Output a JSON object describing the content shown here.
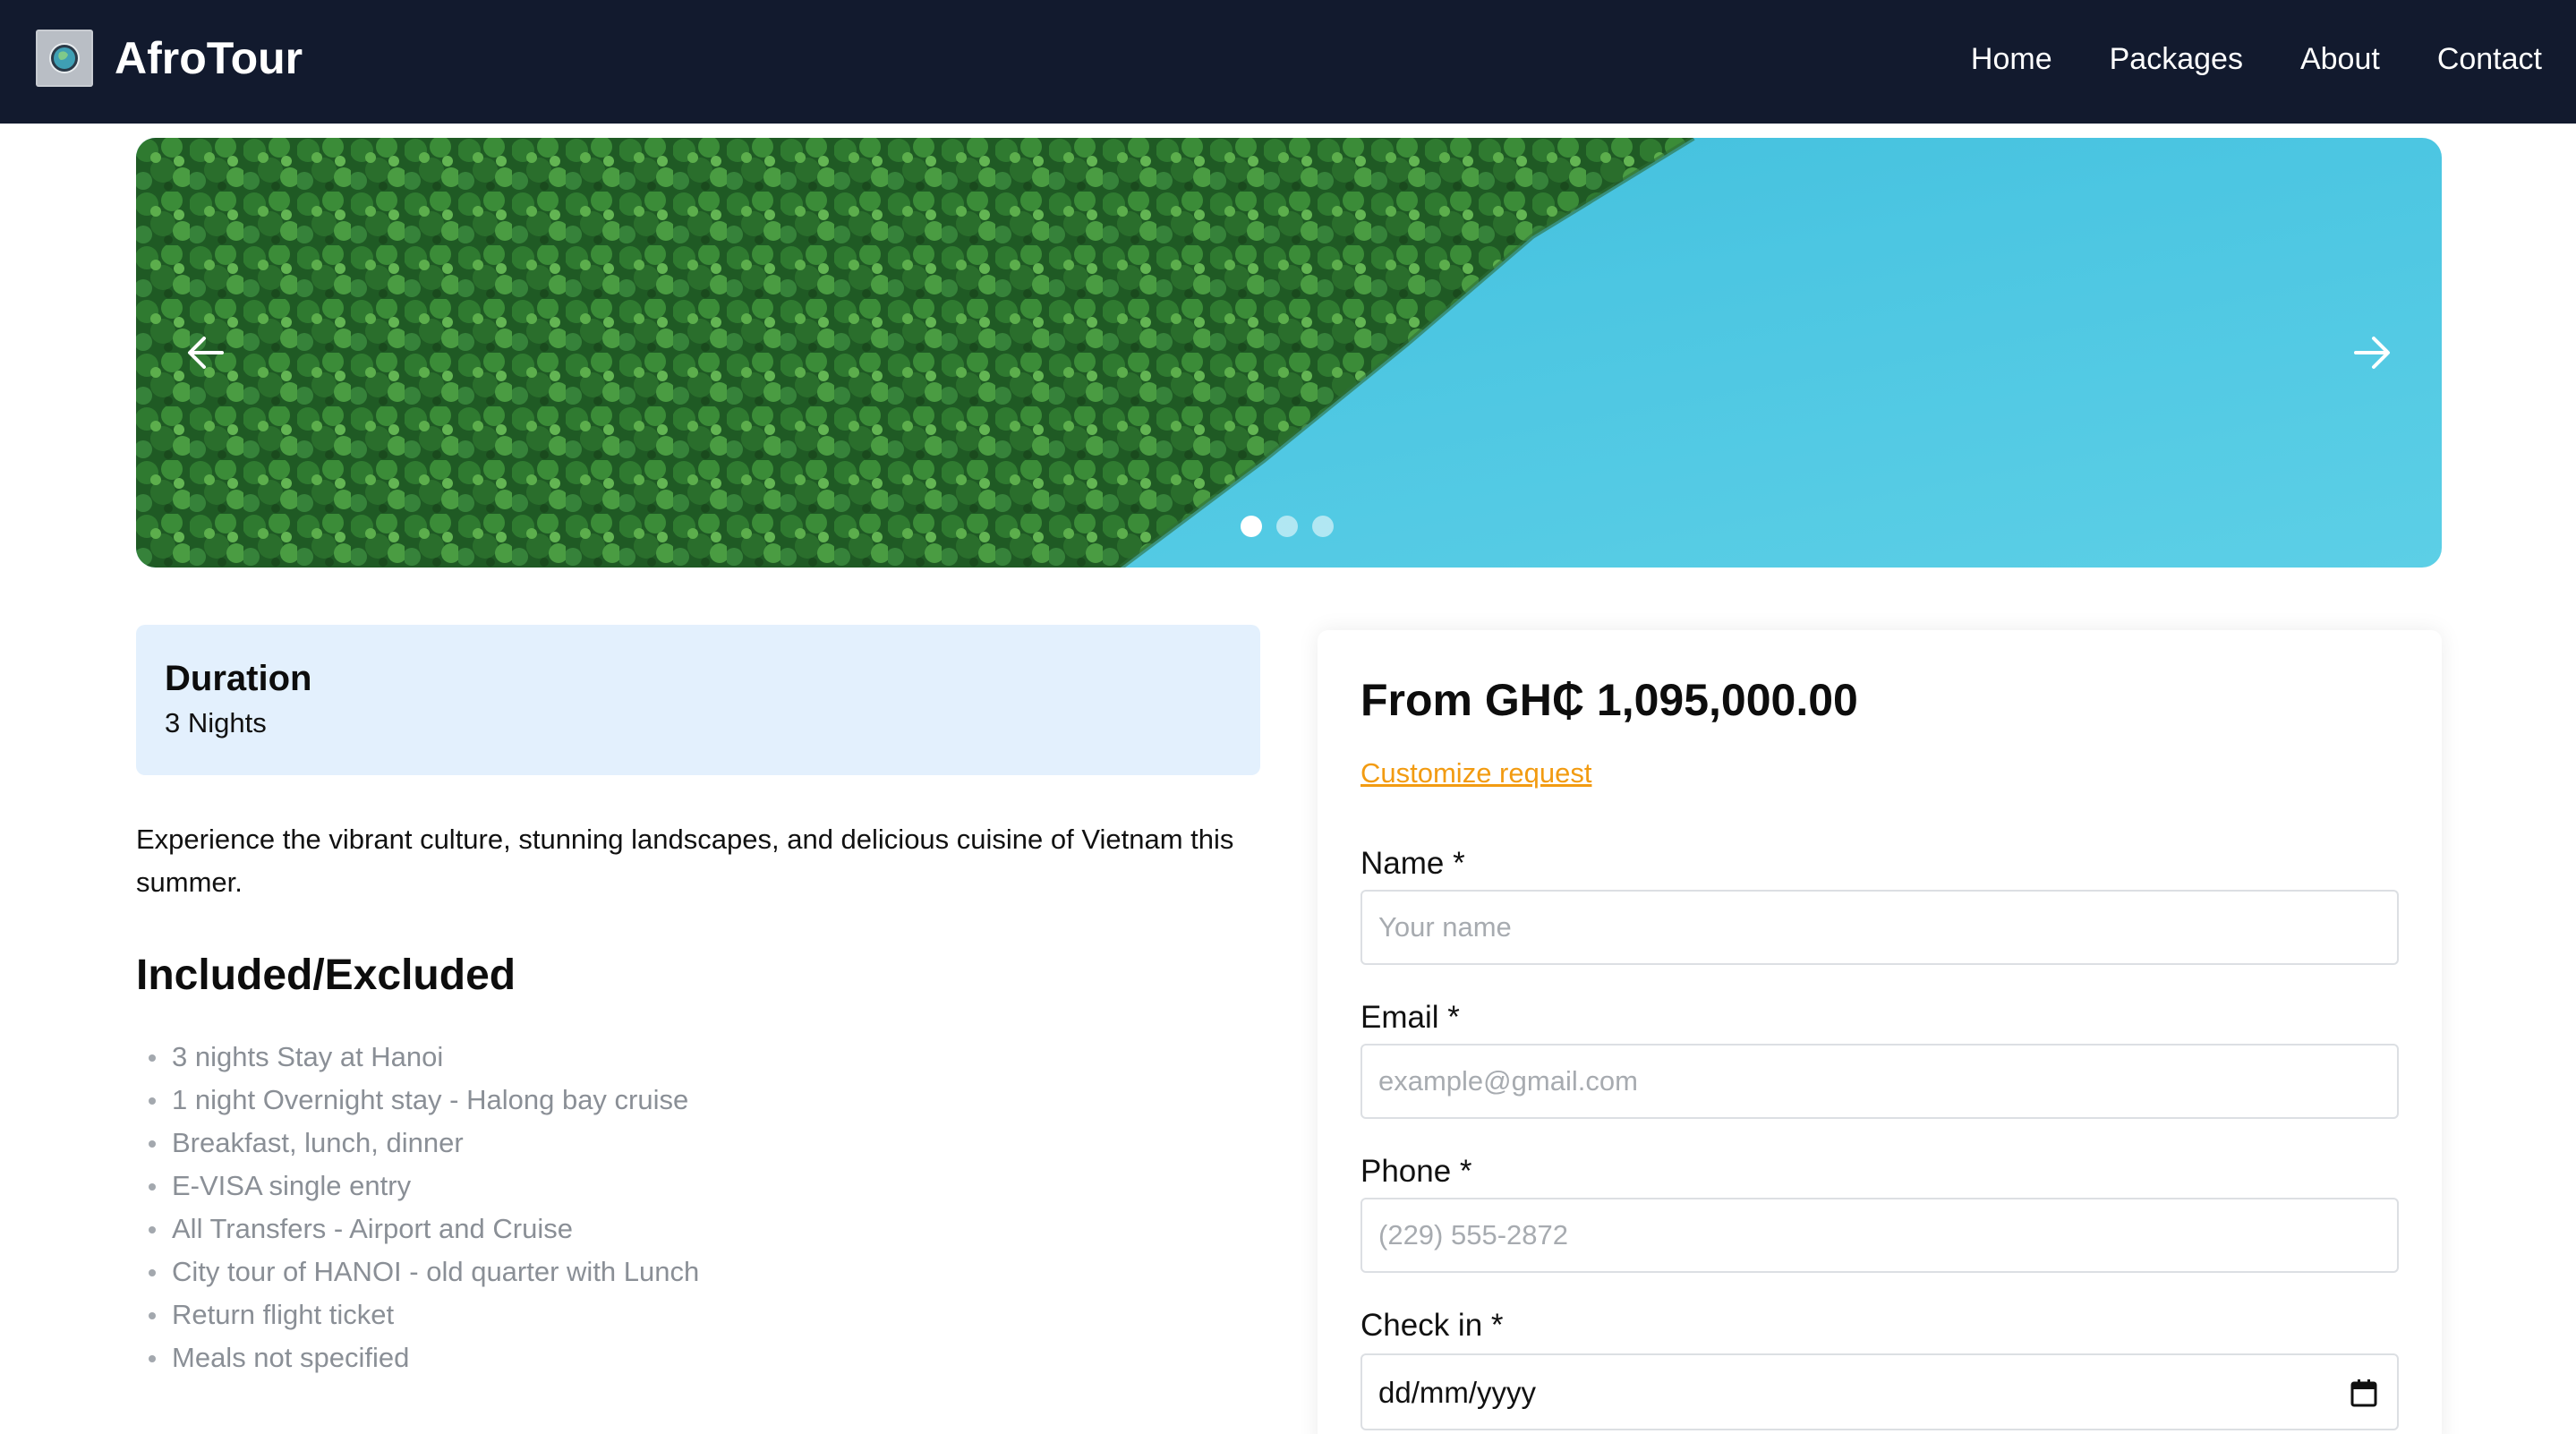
{
  "brand": {
    "name": "AfroTour",
    "logo_icon": "globe-logo-icon"
  },
  "nav": {
    "links": [
      "Home",
      "Packages",
      "About",
      "Contact"
    ]
  },
  "carousel": {
    "slide_count": 3,
    "active_index": 0,
    "prev_icon": "arrow-left-icon",
    "next_icon": "arrow-right-icon"
  },
  "duration": {
    "title": "Duration",
    "value": "3 Nights"
  },
  "description": "Experience the vibrant culture, stunning landscapes, and delicious cuisine of Vietnam this summer.",
  "included": {
    "title": "Included/Excluded",
    "items": [
      "3 nights Stay at Hanoi",
      "1 night Overnight stay - Halong bay cruise",
      "Breakfast, lunch, dinner",
      "E-VISA single entry",
      "All Transfers - Airport and Cruise",
      "City tour of HANOI - old quarter with Lunch",
      "Return flight ticket",
      "Meals not specified"
    ]
  },
  "booking": {
    "price": "From GH₵ 1,095,000.00",
    "customize_label": "Customize request",
    "fields": {
      "name": {
        "label": "Name *",
        "placeholder": "Your name"
      },
      "email": {
        "label": "Email *",
        "placeholder": "example@gmail.com"
      },
      "phone": {
        "label": "Phone *",
        "placeholder": "(229) 555-2872"
      },
      "checkin": {
        "label": "Check in *",
        "value": "dd/mm/yyyy",
        "icon": "calendar-icon"
      }
    }
  },
  "colors": {
    "navbar_bg": "#121a2e",
    "accent_link": "#f29b11",
    "duration_bg": "#e3f0fd",
    "muted_text": "#8a8f96"
  }
}
